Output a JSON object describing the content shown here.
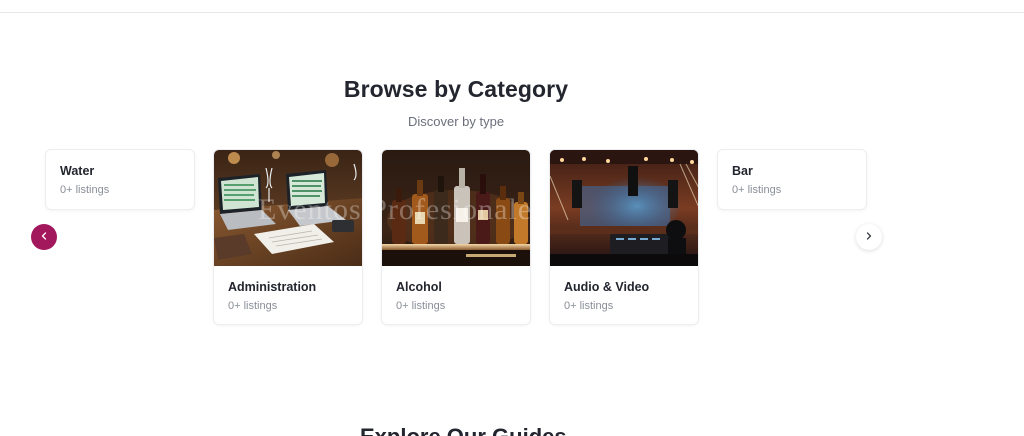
{
  "section": {
    "title": "Browse by Category",
    "subtitle": "Discover by type"
  },
  "carousel": {
    "prev_icon": "chevron-left-icon",
    "next_icon": "chevron-right-icon",
    "accent_color": "#a3175c",
    "cards": [
      {
        "name": "Water",
        "count": "0+ listings"
      },
      {
        "name": "Administration",
        "count": "0+ listings",
        "image": "office-desk-laptops"
      },
      {
        "name": "Alcohol",
        "count": "0+ listings",
        "image": "liquor-bottles-shelf"
      },
      {
        "name": "Audio & Video",
        "count": "0+ listings",
        "image": "concert-stage-lights"
      },
      {
        "name": "Bar",
        "count": "0+ listings"
      }
    ]
  },
  "watermark": "Eventos Profesionales",
  "next_section": {
    "title": "Explore Our Guides"
  }
}
